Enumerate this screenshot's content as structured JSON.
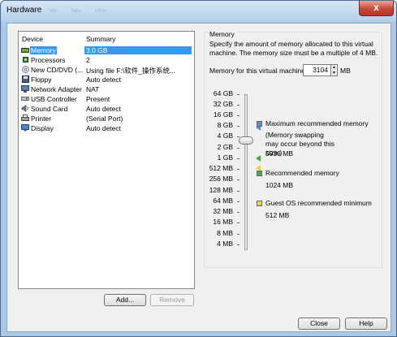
{
  "window": {
    "title": "Hardware",
    "ghost_tabs": [
      "Vip",
      "Tabs",
      "Minin"
    ],
    "close_glyph": "x"
  },
  "device_list": {
    "headers": {
      "device": "Device",
      "summary": "Summary"
    },
    "rows": [
      {
        "device": "Memory",
        "summary": "3.0 GB",
        "icon": "memory-icon",
        "selected": true
      },
      {
        "device": "Processors",
        "summary": "2",
        "icon": "processor-icon"
      },
      {
        "device": "New CD/DVD (...",
        "summary": "Using file F:\\软件_操作系统...",
        "icon": "cd-dvd-icon"
      },
      {
        "device": "Floppy",
        "summary": "Auto detect",
        "icon": "floppy-icon"
      },
      {
        "device": "Network Adapter",
        "summary": "NAT",
        "icon": "network-adapter-icon"
      },
      {
        "device": "USB Controller",
        "summary": "Present",
        "icon": "usb-icon"
      },
      {
        "device": "Sound Card",
        "summary": "Auto detect",
        "icon": "sound-card-icon"
      },
      {
        "device": "Printer",
        "summary": "(Serial Port)",
        "icon": "printer-icon"
      },
      {
        "device": "Display",
        "summary": "Auto detect",
        "icon": "display-icon"
      }
    ]
  },
  "buttons": {
    "add": "Add...",
    "remove": "Remove",
    "close": "Close",
    "help": "Help"
  },
  "memory": {
    "group_title": "Memory",
    "description": "Specify the amount of memory allocated to this virtual machine. The memory size must be a multiple of 4 MB.",
    "field_label": "Memory for this virtual machine:",
    "value": "3104",
    "unit": "MB",
    "scale": [
      "64 GB",
      "32 GB",
      "16 GB",
      "8 GB",
      "4 GB",
      "2 GB",
      "1 GB",
      "512 MB",
      "256 MB",
      "128 MB",
      "64 MB",
      "32 MB",
      "16 MB",
      "8 MB",
      "4 MB"
    ],
    "legend": [
      {
        "title": "Maximum recommended memory",
        "note": "(Memory swapping may occur beyond this size.)",
        "value": "5936 MB",
        "color": "#5b8fd6"
      },
      {
        "title": "Recommended memory",
        "value": "1024 MB",
        "color": "#3fae3f"
      },
      {
        "title": "Guest OS recommended minimum",
        "value": "512 MB",
        "color": "#e8d93a"
      }
    ]
  }
}
